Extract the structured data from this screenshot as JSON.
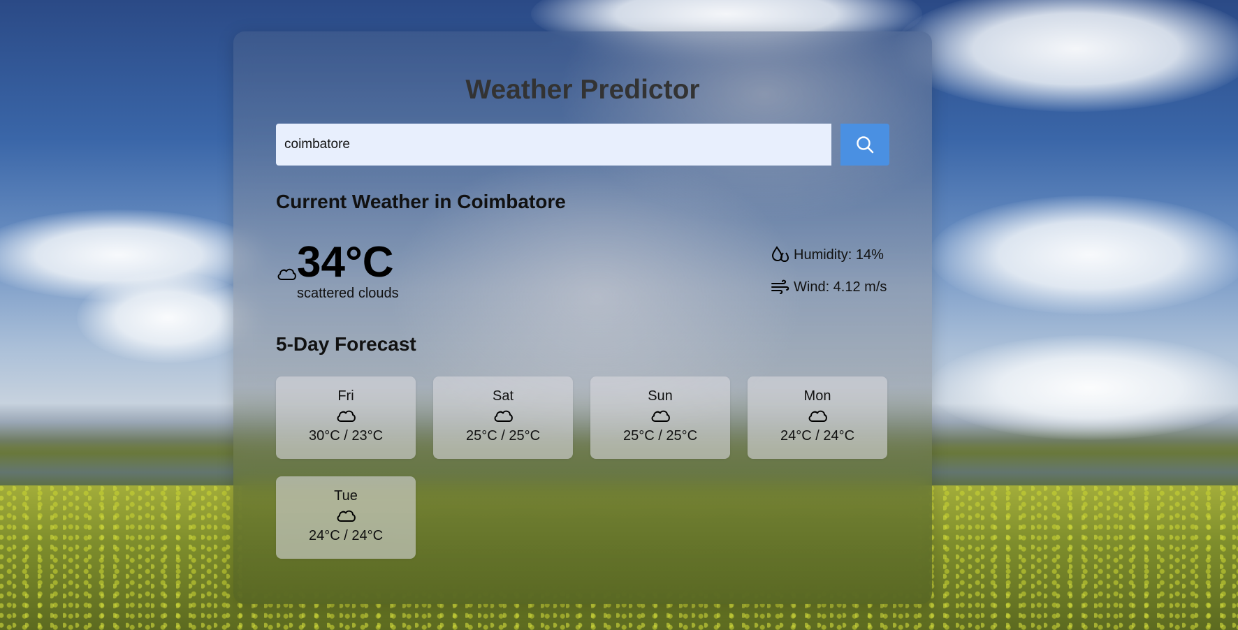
{
  "app": {
    "title": "Weather Predictor"
  },
  "search": {
    "value": "coimbatore",
    "button_icon": "search-icon"
  },
  "current": {
    "heading": "Current Weather in Coimbatore",
    "temperature": "34°C",
    "description": "scattered clouds",
    "icon": "cloud-icon",
    "humidity_label": "Humidity: 14%",
    "humidity_icon": "humidity-drops-icon",
    "wind_label": "Wind: 4.12 m/s",
    "wind_icon": "wind-icon"
  },
  "forecast": {
    "heading": "5-Day Forecast",
    "days": [
      {
        "day": "Fri",
        "temps": "30°C / 23°C",
        "icon": "cloud-icon"
      },
      {
        "day": "Sat",
        "temps": "25°C / 25°C",
        "icon": "cloud-icon"
      },
      {
        "day": "Sun",
        "temps": "25°C / 25°C",
        "icon": "cloud-icon"
      },
      {
        "day": "Mon",
        "temps": "24°C / 24°C",
        "icon": "cloud-icon"
      },
      {
        "day": "Tue",
        "temps": "24°C / 24°C",
        "icon": "cloud-icon"
      }
    ]
  },
  "colors": {
    "accent": "#4a90e2",
    "title": "#333333",
    "input_bg": "#e8effd"
  }
}
